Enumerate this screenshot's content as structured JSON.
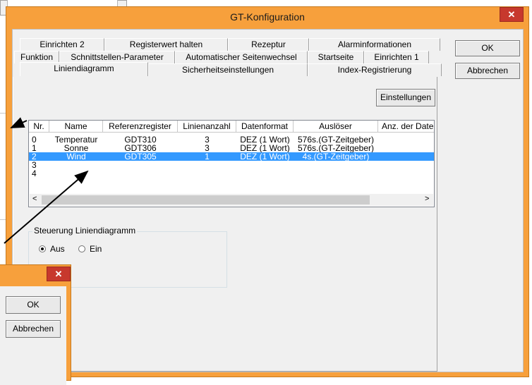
{
  "dialog": {
    "title": "GT-Konfiguration",
    "close_glyph": "✕",
    "buttons": {
      "ok": "OK",
      "cancel": "Abbrechen"
    },
    "tabs_row1": [
      "Einrichten 2",
      "Registerwert halten",
      "Rezeptur",
      "Alarminformationen"
    ],
    "tabs_row2": [
      "Funktion",
      "Schnittstellen-Parameter",
      "Automatischer Seitenwechsel",
      "Startseite",
      "Einrichten 1"
    ],
    "tabs_row3": [
      "Liniendiagramm",
      "Sicherheitseinstellungen",
      "Index-Registrierung"
    ],
    "active_tab": "Liniendiagramm",
    "settings_button": "Einstellungen",
    "table": {
      "columns": [
        "Nr.",
        "Name",
        "Referenzregister",
        "Linienanzahl",
        "Datenformat",
        "Auslöser",
        "Anz. der Date"
      ],
      "rows": [
        [
          "0",
          "Temperatur",
          "GDT310",
          "3",
          "DEZ (1 Wort)",
          "576s.(GT-Zeitgeber)",
          ""
        ],
        [
          "1",
          "Sonne",
          "GDT306",
          "3",
          "DEZ (1 Wort)",
          "576s.(GT-Zeitgeber)",
          ""
        ],
        [
          "2",
          "Wind",
          "GDT305",
          "1",
          "DEZ (1 Wort)",
          "4s.(GT-Zeitgeber)",
          ""
        ],
        [
          "3",
          "",
          "",
          "",
          "",
          "",
          ""
        ],
        [
          "4",
          "",
          "",
          "",
          "",
          "",
          ""
        ]
      ],
      "selected_row": 2,
      "scroll_left_glyph": "<",
      "scroll_right_glyph": ">"
    },
    "group": {
      "title": "Steuerung Liniendiagramm",
      "option_off": "Aus",
      "option_on": "Ein",
      "selected": "Aus"
    }
  },
  "small_dialog": {
    "close_glyph": "✕",
    "buttons": {
      "ok": "OK",
      "cancel": "Abbrechen"
    }
  },
  "colors": {
    "frame": "#f7a03c",
    "close": "#c7382d",
    "selection": "#3399ff"
  }
}
